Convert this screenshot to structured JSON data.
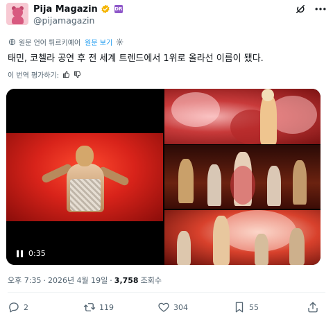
{
  "account": {
    "display_name": "Pija Magazin",
    "handle": "@pijamagazin",
    "verified": true,
    "affiliate_badge": "DR",
    "brand_color": "#8e57c9",
    "verified_color": "#f4b400"
  },
  "actions": {
    "grok_icon": "grok-icon",
    "more_icon": "more-icon"
  },
  "translation": {
    "note": "원문 언어 튀르키예어",
    "view_original_label": "원문 보기",
    "link_color": "#1d9bf0"
  },
  "tweet": {
    "text": "태민, 코첼라 공연 후 전 세계 트렌드에서 1위로 올라선 이름이 됐다."
  },
  "rate_translation": {
    "label": "이 번역 평가하기:"
  },
  "media": {
    "video": {
      "duration": "0:35",
      "state": "playing"
    },
    "photos": [
      "photo-1",
      "photo-2",
      "photo-3"
    ]
  },
  "meta": {
    "time": "오후 7:35",
    "separator": "·",
    "date": "2026년 4월 19일",
    "views_count": "3,758",
    "views_label": "조회수"
  },
  "engagement": {
    "replies": "2",
    "reposts": "119",
    "likes": "304",
    "bookmarks": "55"
  }
}
